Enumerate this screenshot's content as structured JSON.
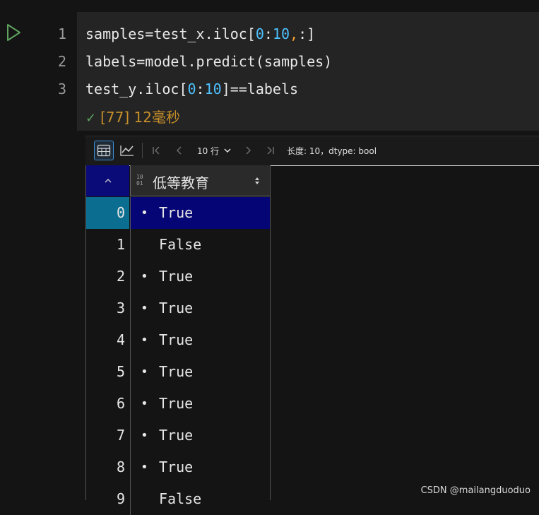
{
  "editor": {
    "line_numbers": [
      "1",
      "2",
      "3"
    ],
    "lines": [
      [
        {
          "t": "samples=test_x.iloc["
        },
        {
          "t": "0",
          "c": "num"
        },
        {
          "t": ":"
        },
        {
          "t": "10",
          "c": "num"
        },
        {
          "t": ",",
          "c": "comma"
        },
        {
          "t": ":]"
        }
      ],
      [
        {
          "t": "labels=model.predict(samples)"
        }
      ],
      [
        {
          "t": "test_y.iloc["
        },
        {
          "t": "0",
          "c": "num"
        },
        {
          "t": ":"
        },
        {
          "t": "10",
          "c": "num"
        },
        {
          "t": "]==labels"
        }
      ]
    ],
    "status": "[77] 12毫秒"
  },
  "toolbar": {
    "rows_label": "10 行",
    "info": "长度: 10，dtype: bool"
  },
  "table": {
    "column_type": [
      "10",
      "01"
    ],
    "column_name": "低等教育",
    "rows": [
      {
        "index": "0",
        "value": "True",
        "bullet": true,
        "selected": true
      },
      {
        "index": "1",
        "value": "False",
        "bullet": false
      },
      {
        "index": "2",
        "value": "True",
        "bullet": true
      },
      {
        "index": "3",
        "value": "True",
        "bullet": true
      },
      {
        "index": "4",
        "value": "True",
        "bullet": true
      },
      {
        "index": "5",
        "value": "True",
        "bullet": true
      },
      {
        "index": "6",
        "value": "True",
        "bullet": true
      },
      {
        "index": "7",
        "value": "True",
        "bullet": true
      },
      {
        "index": "8",
        "value": "True",
        "bullet": true
      },
      {
        "index": "9",
        "value": "False",
        "bullet": false
      }
    ]
  },
  "watermark": "CSDN @mailangduoduo",
  "colors": {
    "background": "#141414",
    "cell_background": "#242424",
    "number_literal": "#4fc1ff",
    "comma": "#f0a030",
    "status_text": "#c8902a",
    "run_icon": "#5fa35f",
    "selected_row": "#050575",
    "selected_index": "#0b6d8f"
  }
}
